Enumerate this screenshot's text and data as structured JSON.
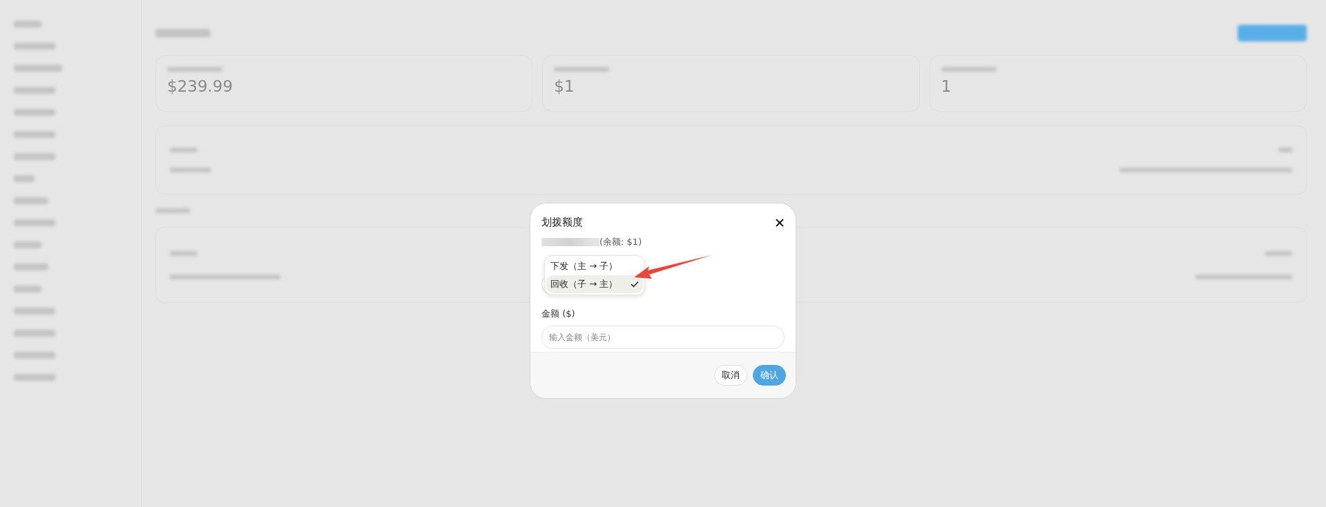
{
  "stats": [
    {
      "value": "$239.99"
    },
    {
      "value": "$1"
    },
    {
      "value": "1"
    }
  ],
  "dialog": {
    "title": "划拨额度",
    "balance": "(余额: $1)",
    "direction_menu": [
      {
        "label": "下发（主 → 子）",
        "selected": false
      },
      {
        "label": "回收（子 → 主）",
        "selected": true
      }
    ],
    "amount_label": "金额 ($)",
    "amount_placeholder": "输入金额（美元）",
    "buttons": [
      {
        "label": "取消",
        "kind": "secondary"
      },
      {
        "label": "确认",
        "kind": "primary"
      }
    ]
  }
}
